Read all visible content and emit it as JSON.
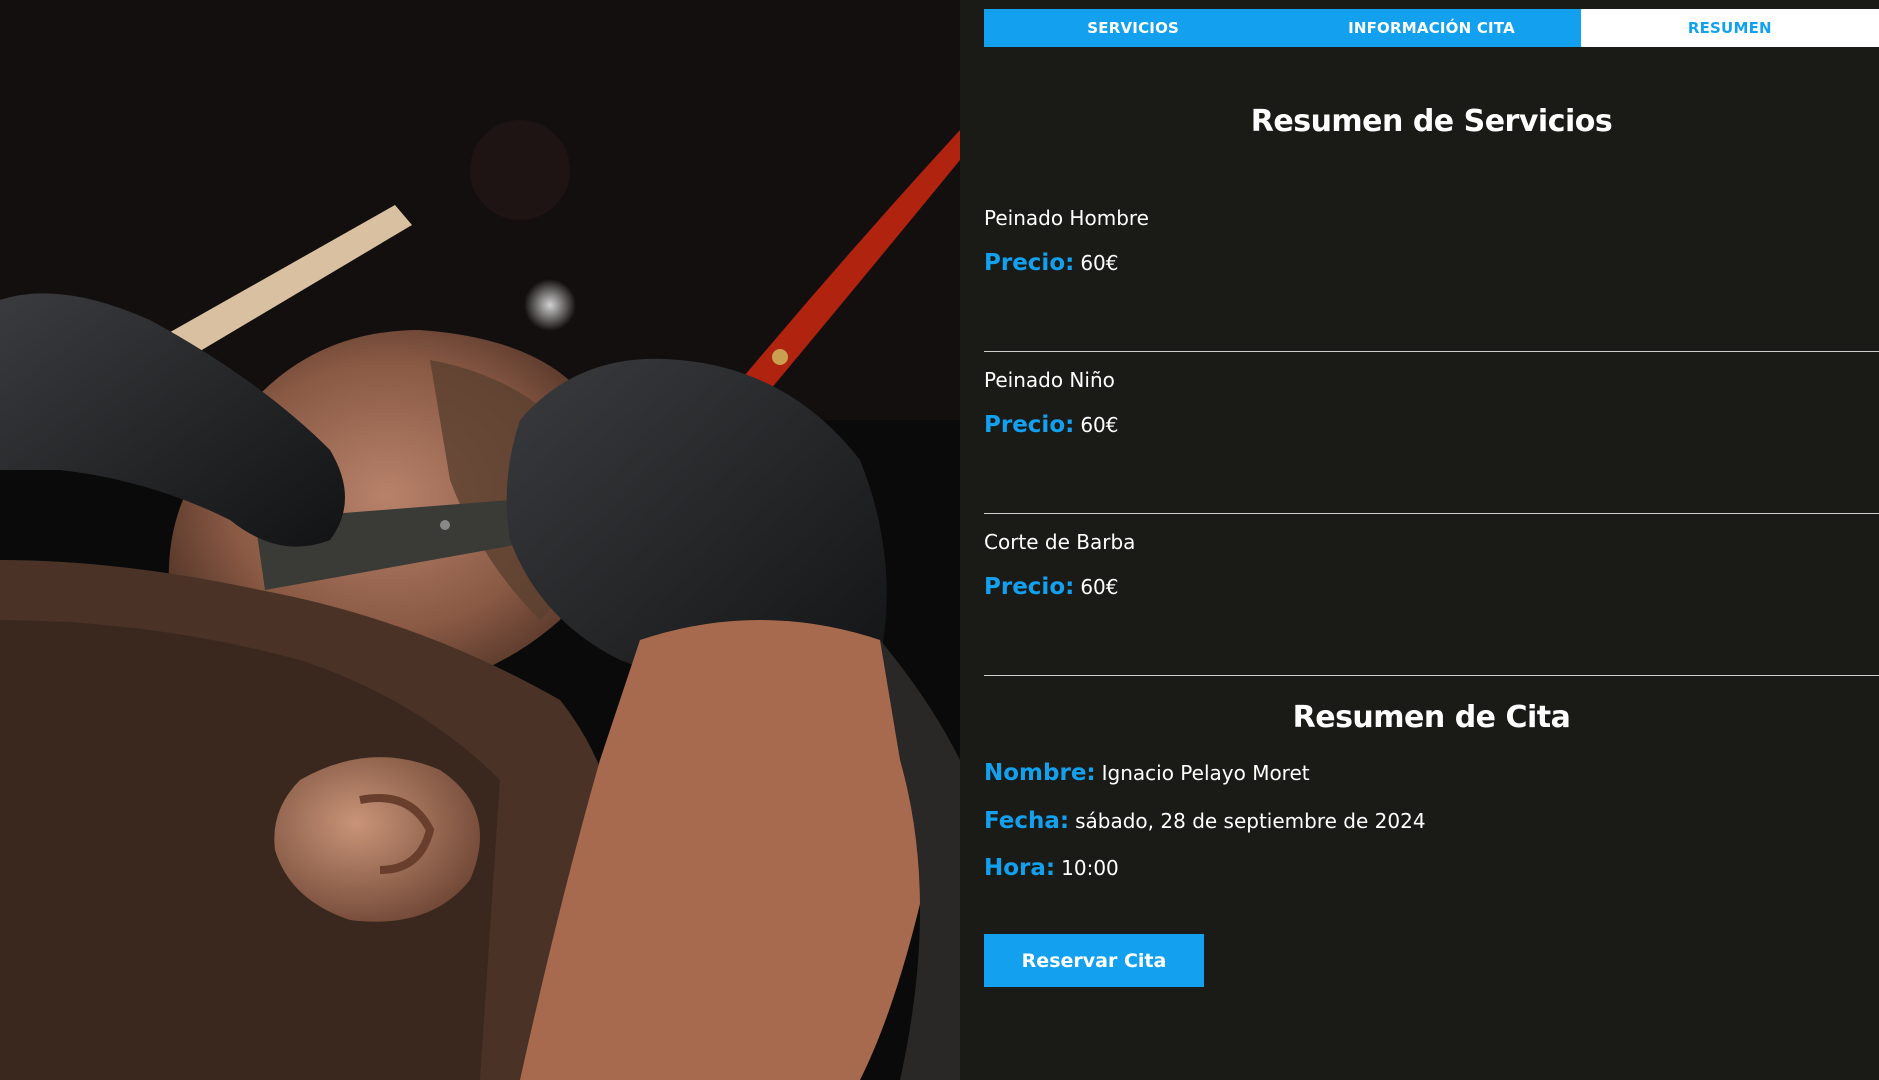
{
  "hero": {
    "image_icon": "barber-shaving-photo"
  },
  "tabs": [
    {
      "label": "SERVICIOS",
      "active": false
    },
    {
      "label": "INFORMACIÓN CITA",
      "active": false
    },
    {
      "label": "RESUMEN",
      "active": true
    }
  ],
  "services_summary": {
    "title": "Resumen de Servicios",
    "price_label": "Precio:",
    "items": [
      {
        "name": "Peinado Hombre",
        "price": "60€"
      },
      {
        "name": "Peinado Niño",
        "price": "60€"
      },
      {
        "name": "Corte de Barba",
        "price": "60€"
      }
    ]
  },
  "appointment_summary": {
    "title": "Resumen de Cita",
    "name_label": "Nombre:",
    "name_value": "Ignacio Pelayo Moret",
    "date_label": "Fecha:",
    "date_value": "sábado, 28 de septiembre de 2024",
    "time_label": "Hora:",
    "time_value": "10:00"
  },
  "actions": {
    "reserve_label": "Reservar Cita"
  },
  "colors": {
    "accent": "#13a1ef",
    "background": "#1a1a17",
    "text": "#ffffff"
  }
}
